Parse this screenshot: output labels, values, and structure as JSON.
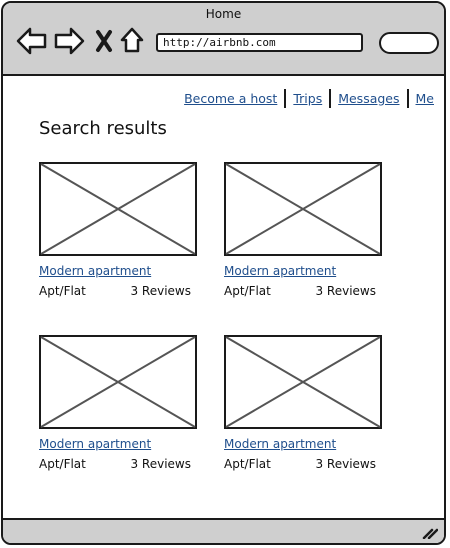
{
  "window": {
    "title": "Home"
  },
  "toolbar": {
    "back_icon": "back-arrow-icon",
    "forward_icon": "forward-arrow-icon",
    "close_icon": "close-x-icon",
    "home_icon": "home-icon",
    "url": "http://airbnb.com",
    "search_icon": "search-pill-icon"
  },
  "nav": {
    "links": [
      "Become a host",
      "Trips",
      "Messages",
      "Me"
    ]
  },
  "main": {
    "title": "Search results",
    "listings": [
      {
        "title": "Modern apartment",
        "type": "Apt/Flat",
        "reviews": "3 Reviews",
        "image_icon": "image-placeholder-icon"
      },
      {
        "title": "Modern apartment",
        "type": "Apt/Flat",
        "reviews": "3 Reviews",
        "image_icon": "image-placeholder-icon"
      },
      {
        "title": "Modern apartment",
        "type": "Apt/Flat",
        "reviews": "3 Reviews",
        "image_icon": "image-placeholder-icon"
      },
      {
        "title": "Modern apartment",
        "type": "Apt/Flat",
        "reviews": "3 Reviews",
        "image_icon": "image-placeholder-icon"
      }
    ]
  },
  "statusbar": {
    "resize_icon": "resize-grip-icon"
  },
  "colors": {
    "link": "#1f4e8c",
    "chrome": "#cfcfcf",
    "border": "#1a1a1a"
  }
}
